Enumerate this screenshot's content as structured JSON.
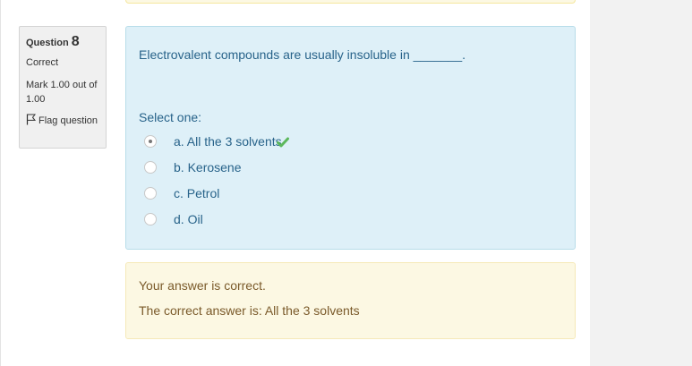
{
  "question": {
    "label": "Question",
    "number": "8",
    "state": "Correct",
    "grade": "Mark 1.00 out of 1.00",
    "flag_label": "Flag question",
    "text": "Electrovalent compounds are usually insoluble in _______.",
    "prompt": "Select one:",
    "options": [
      {
        "label": "a. All the 3 solvents",
        "selected": true,
        "correct": true
      },
      {
        "label": "b. Kerosene",
        "selected": false
      },
      {
        "label": "c. Petrol",
        "selected": false
      },
      {
        "label": "d. Oil",
        "selected": false
      }
    ]
  },
  "outcome": {
    "feedback": "Your answer is correct.",
    "right_answer": "The correct answer is: All the 3 solvents"
  },
  "colors": {
    "formulation_bg": "#def0f8",
    "outcome_bg": "#fcf8e3",
    "text_blue": "#28638a",
    "correct_tick": "#5cb85c"
  },
  "icons": [
    "flag-icon",
    "correct-tick-icon"
  ]
}
